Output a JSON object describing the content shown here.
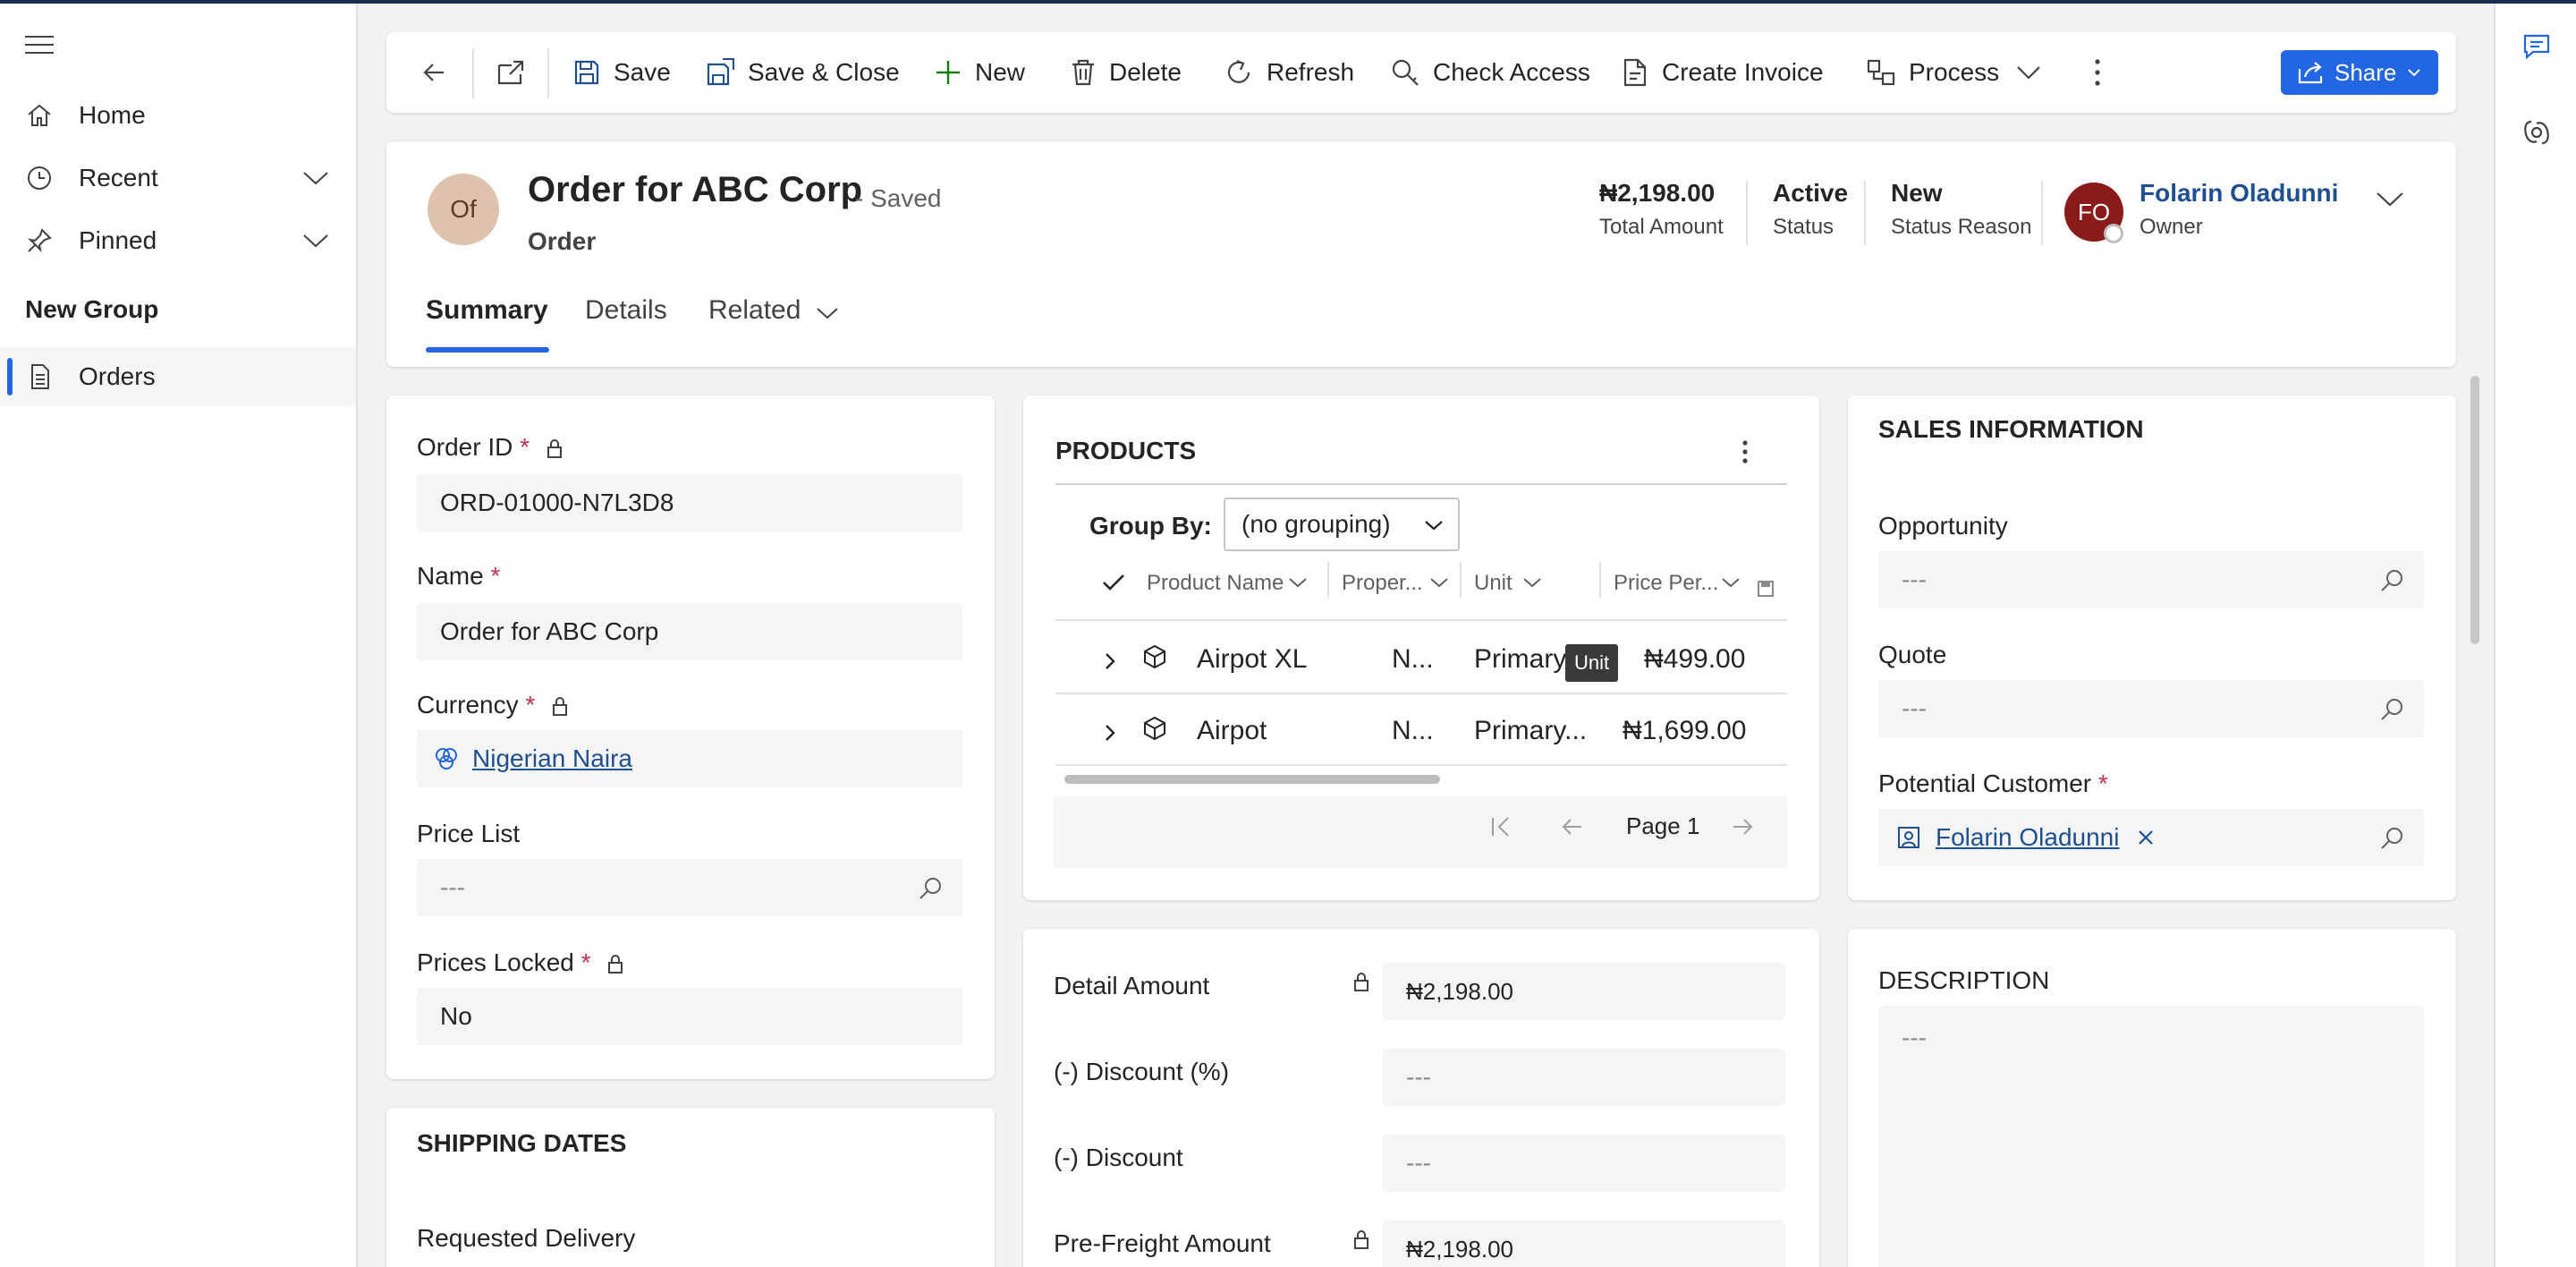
{
  "nav": {
    "home": "Home",
    "recent": "Recent",
    "pinned": "Pinned",
    "group_title": "New Group",
    "orders": "Orders"
  },
  "toolbar": {
    "save": "Save",
    "save_close": "Save & Close",
    "new": "New",
    "delete": "Delete",
    "refresh": "Refresh",
    "check_access": "Check Access",
    "create_invoice": "Create Invoice",
    "process": "Process",
    "share": "Share"
  },
  "header": {
    "avatar_initials": "Of",
    "title": "Order for ABC Corp",
    "saved_status": "- Saved",
    "entity": "Order",
    "total_amount_value": "₦2,198.00",
    "total_amount_label": "Total Amount",
    "status_value": "Active",
    "status_label": "Status",
    "status_reason_value": "New",
    "status_reason_label": "Status Reason",
    "owner_initials": "FO",
    "owner_name": "Folarin Oladunni",
    "owner_label": "Owner",
    "tabs": [
      "Summary",
      "Details",
      "Related"
    ]
  },
  "general": {
    "order_id_label": "Order ID",
    "order_id": "ORD-01000-N7L3D8",
    "name_label": "Name",
    "name": "Order for ABC Corp",
    "currency_label": "Currency",
    "currency": "Nigerian Naira",
    "price_list_label": "Price List",
    "price_list": "---",
    "prices_locked_label": "Prices Locked",
    "prices_locked": "No",
    "required_mark": "*"
  },
  "shipping": {
    "title": "SHIPPING DATES",
    "requested_delivery_label": "Requested Delivery"
  },
  "products": {
    "title": "PRODUCTS",
    "group_by_label": "Group By:",
    "group_by_value": "(no grouping)",
    "columns": [
      "Product Name",
      "Proper...",
      "Unit",
      "Price Per..."
    ],
    "rows": [
      {
        "name": "Airpot XL",
        "properties": "N...",
        "unit": "Primary",
        "price": "₦499.00"
      },
      {
        "name": "Airpot",
        "properties": "N...",
        "unit": "Primary...",
        "price": "₦1,699.00"
      }
    ],
    "tooltip": "Unit",
    "page": "Page 1"
  },
  "totals": {
    "detail_amount_label": "Detail Amount",
    "detail_amount": "₦2,198.00",
    "discount_pct_label": "(-) Discount (%)",
    "discount_pct": "---",
    "discount_label": "(-) Discount",
    "discount": "---",
    "pre_freight_label": "Pre-Freight Amount",
    "pre_freight": "₦2,198.00"
  },
  "sales": {
    "title": "SALES INFORMATION",
    "opportunity_label": "Opportunity",
    "opportunity": "---",
    "quote_label": "Quote",
    "quote": "---",
    "potential_customer_label": "Potential Customer",
    "potential_customer": "Folarin Oladunni"
  },
  "description": {
    "title": "DESCRIPTION",
    "value": "---"
  },
  "colors": {
    "accent": "#2266e3",
    "link": "#1d4f91",
    "required": "#c4314b",
    "owner_avatar": "#8b1a1a",
    "record_avatar": "#dec2ad"
  }
}
